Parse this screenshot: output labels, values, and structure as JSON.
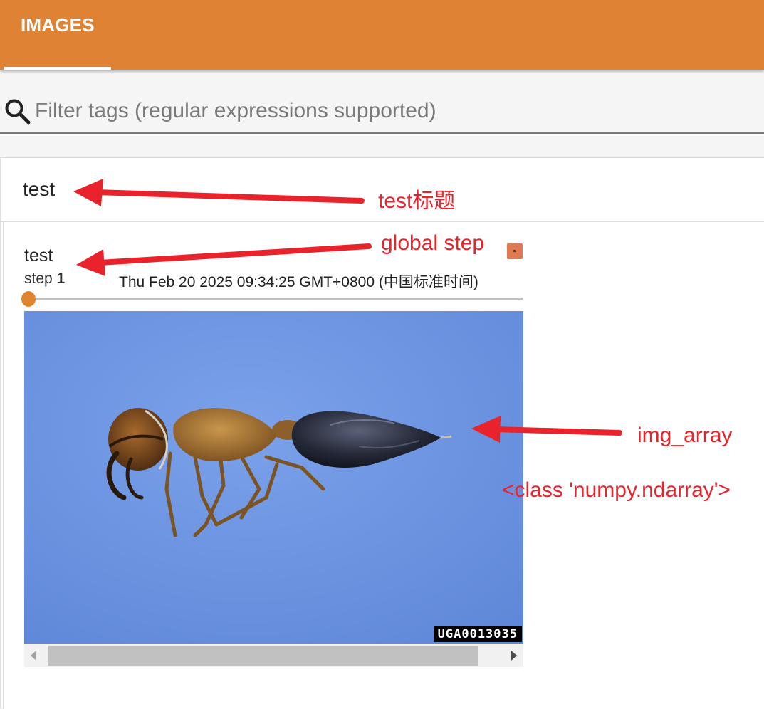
{
  "toolbar": {
    "tab_label": "IMAGES"
  },
  "filter": {
    "placeholder": "Filter tags (regular expressions supported)"
  },
  "tag_section": {
    "title": "test"
  },
  "card": {
    "title": "test",
    "step_label": "step",
    "step_value": "1",
    "timestamp": "Thu Feb 20 2025 09:34:25 GMT+0800 (中国标准时间)",
    "image_overlay_text": "UGA0013035",
    "slider_position": 0
  },
  "annotations": {
    "test_title": "test标题",
    "global_step": "global step",
    "img_array": "img_array",
    "class_note": "<class 'numpy.ndarray'>"
  },
  "colors": {
    "header": "#e08233",
    "annotation": "#e8232b",
    "image_background": "#6b93e0"
  },
  "icons": {
    "search": "search-icon",
    "expand": "expand-icon",
    "scroll_left": "chevron-left-icon",
    "scroll_right": "chevron-right-icon"
  }
}
